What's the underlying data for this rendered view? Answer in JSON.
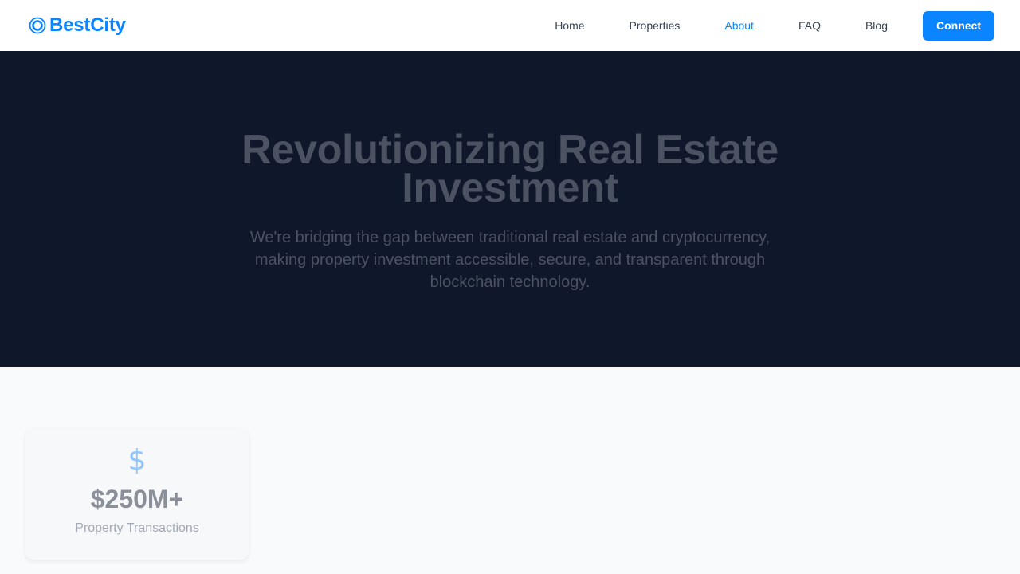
{
  "brand": {
    "name": "BestCity",
    "icon": "circle-target-icon",
    "color": "#0a84ff"
  },
  "nav": {
    "items": [
      {
        "label": "Home",
        "active": false
      },
      {
        "label": "Properties",
        "active": false
      },
      {
        "label": "About",
        "active": true
      },
      {
        "label": "FAQ",
        "active": false
      },
      {
        "label": "Blog",
        "active": false
      }
    ],
    "connect_label": "Connect"
  },
  "hero": {
    "title": "Revolutionizing Real Estate Investment",
    "subtitle": "We're bridging the gap between traditional real estate and cryptocurrency, making property investment accessible, secure, and transparent through blockchain technology.",
    "background": "#0f172a"
  },
  "stats": [
    {
      "icon": "dollar-icon",
      "icon_glyph": "$",
      "value": "$250M+",
      "label": "Property Transactions"
    }
  ],
  "colors": {
    "accent": "#0a84ff",
    "hero_bg": "#0f172a",
    "page_bg": "#f8fafc"
  }
}
